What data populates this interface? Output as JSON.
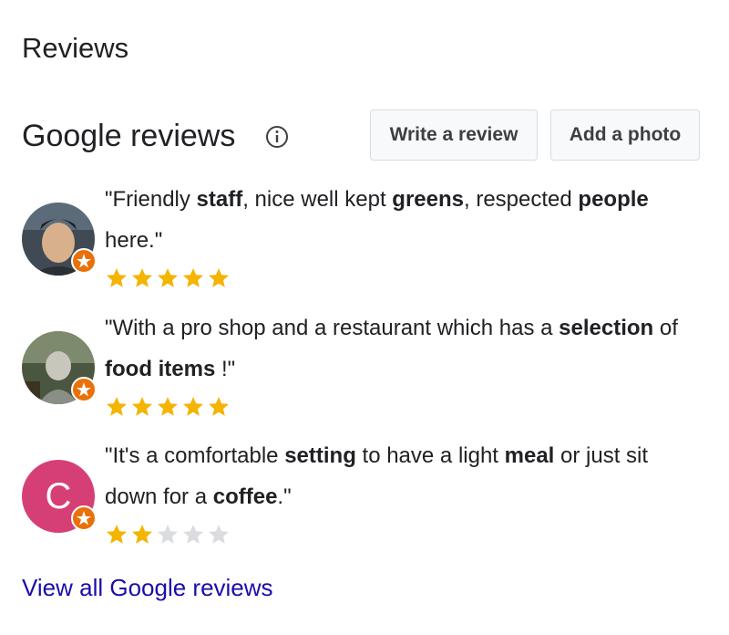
{
  "section": {
    "title": "Reviews"
  },
  "google_reviews": {
    "title": "Google reviews",
    "info_icon": "info-icon",
    "write_review_label": "Write a review",
    "add_photo_label": "Add a photo"
  },
  "reviews": [
    {
      "avatar": "photo",
      "avatar_color": "#4a5a6a",
      "badge_icon": "local-guide-badge-icon",
      "quote_parts": [
        "\"Friendly ",
        "staff",
        ", nice well kept ",
        "greens",
        ", respected ",
        "people",
        " here.\""
      ],
      "rating": 5
    },
    {
      "avatar": "photo",
      "avatar_color": "#5d6b55",
      "badge_icon": "local-guide-badge-icon",
      "quote_parts": [
        "\"With a pro shop and a restaurant which has a ",
        "selection",
        " of ",
        "food items",
        " !\""
      ],
      "rating": 5
    },
    {
      "avatar": "C",
      "avatar_color": "#d63f76",
      "badge_icon": "local-guide-badge-icon",
      "quote_parts": [
        "\"It's a comfortable ",
        "setting",
        " to have a light ",
        "meal",
        " or just sit down for a ",
        "coffee",
        ".\""
      ],
      "rating": 2
    }
  ],
  "rating_max": 5,
  "star_colors": {
    "filled": "#f4b400",
    "empty": "#dadce0"
  },
  "view_all_label": "View all Google reviews"
}
